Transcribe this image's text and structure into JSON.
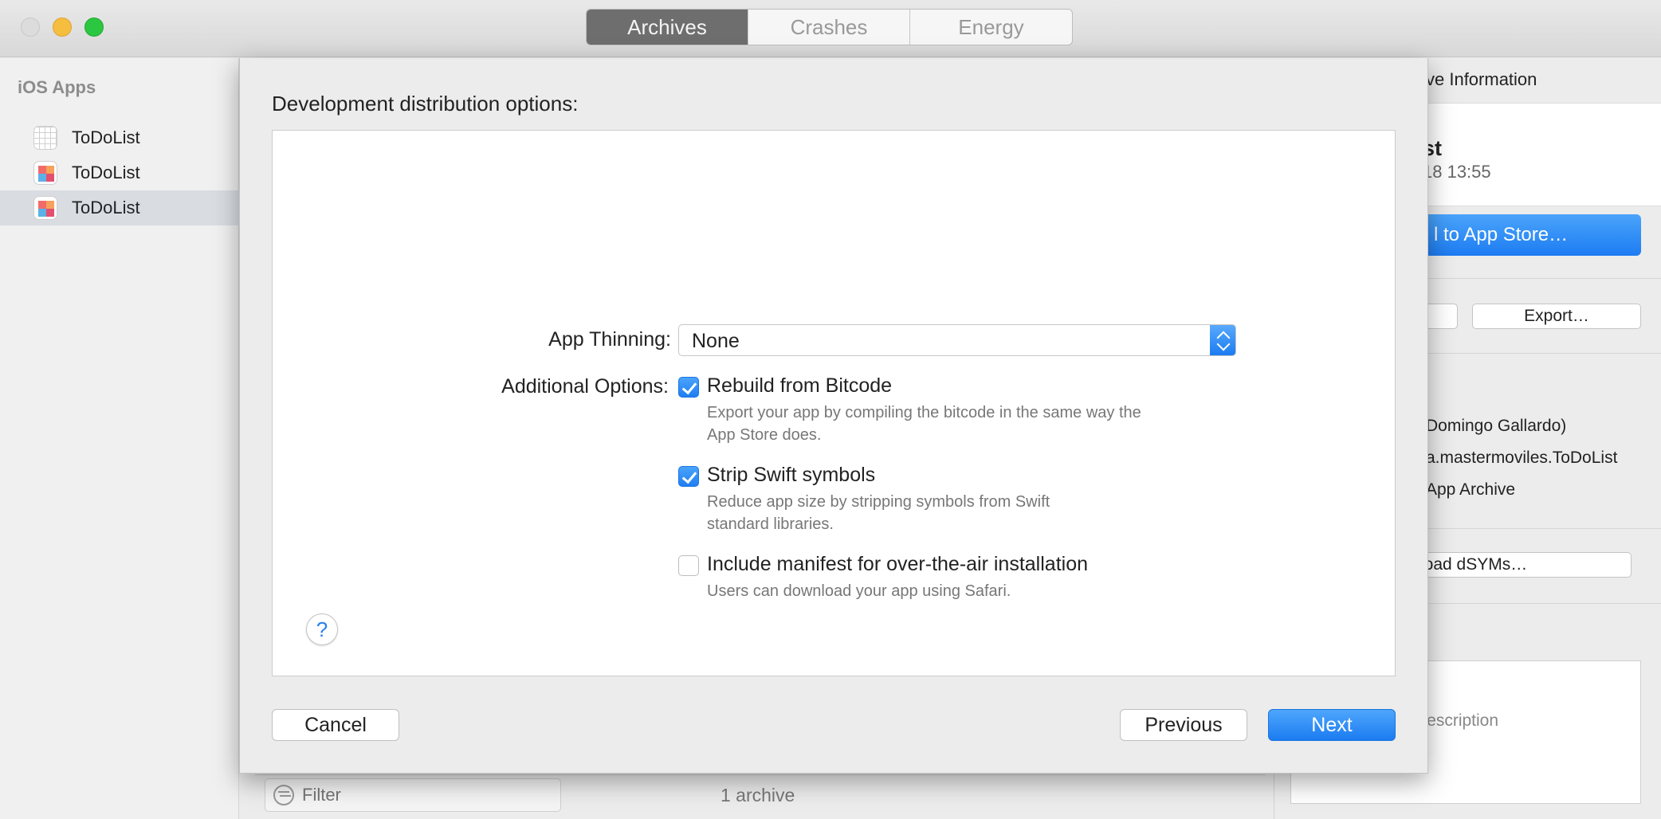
{
  "toolbar": {
    "tabs": [
      {
        "label": "Archives",
        "active": true
      },
      {
        "label": "Crashes",
        "active": false
      },
      {
        "label": "Energy",
        "active": false
      }
    ]
  },
  "sidebar": {
    "header": "iOS Apps",
    "items": [
      {
        "label": "ToDoList",
        "icon": "placeholder-grid-icon"
      },
      {
        "label": "ToDoList",
        "icon": "app-icon"
      },
      {
        "label": "ToDoList",
        "icon": "app-icon",
        "selected": true
      }
    ]
  },
  "info_pane": {
    "heading": "ve Information",
    "name": "st",
    "date": "18 13:55",
    "upload_button": "l to App Store…",
    "export_button": "Export…",
    "team": "Domingo Gallardo)",
    "bundle": "a.mastermoviles.ToDoList",
    "type": "App Archive",
    "dsyms_button": "load dSYMs…",
    "description_placeholder": "Description"
  },
  "bottom_bar": {
    "filter_placeholder": "Filter",
    "archive_count": "1 archive"
  },
  "sheet": {
    "title": "Development distribution options:",
    "app_thinning_label": "App Thinning:",
    "app_thinning_value": "None",
    "additional_options_label": "Additional Options:",
    "options": [
      {
        "title": "Rebuild from Bitcode",
        "checked": true,
        "desc_line1": "Export your app by compiling the bitcode in the same way the",
        "desc_line2": "App Store does."
      },
      {
        "title": "Strip Swift symbols",
        "checked": true,
        "desc_line1": "Reduce app size by stripping symbols from Swift",
        "desc_line2": "standard libraries."
      },
      {
        "title": "Include manifest for over-the-air installation",
        "checked": false,
        "desc_line1": "Users can download your app using Safari.",
        "desc_line2": ""
      }
    ],
    "help_label": "?",
    "cancel_label": "Cancel",
    "previous_label": "Previous",
    "next_label": "Next"
  },
  "colors": {
    "accent": "#1d7cf2",
    "selected_row": "#d9dde2"
  }
}
